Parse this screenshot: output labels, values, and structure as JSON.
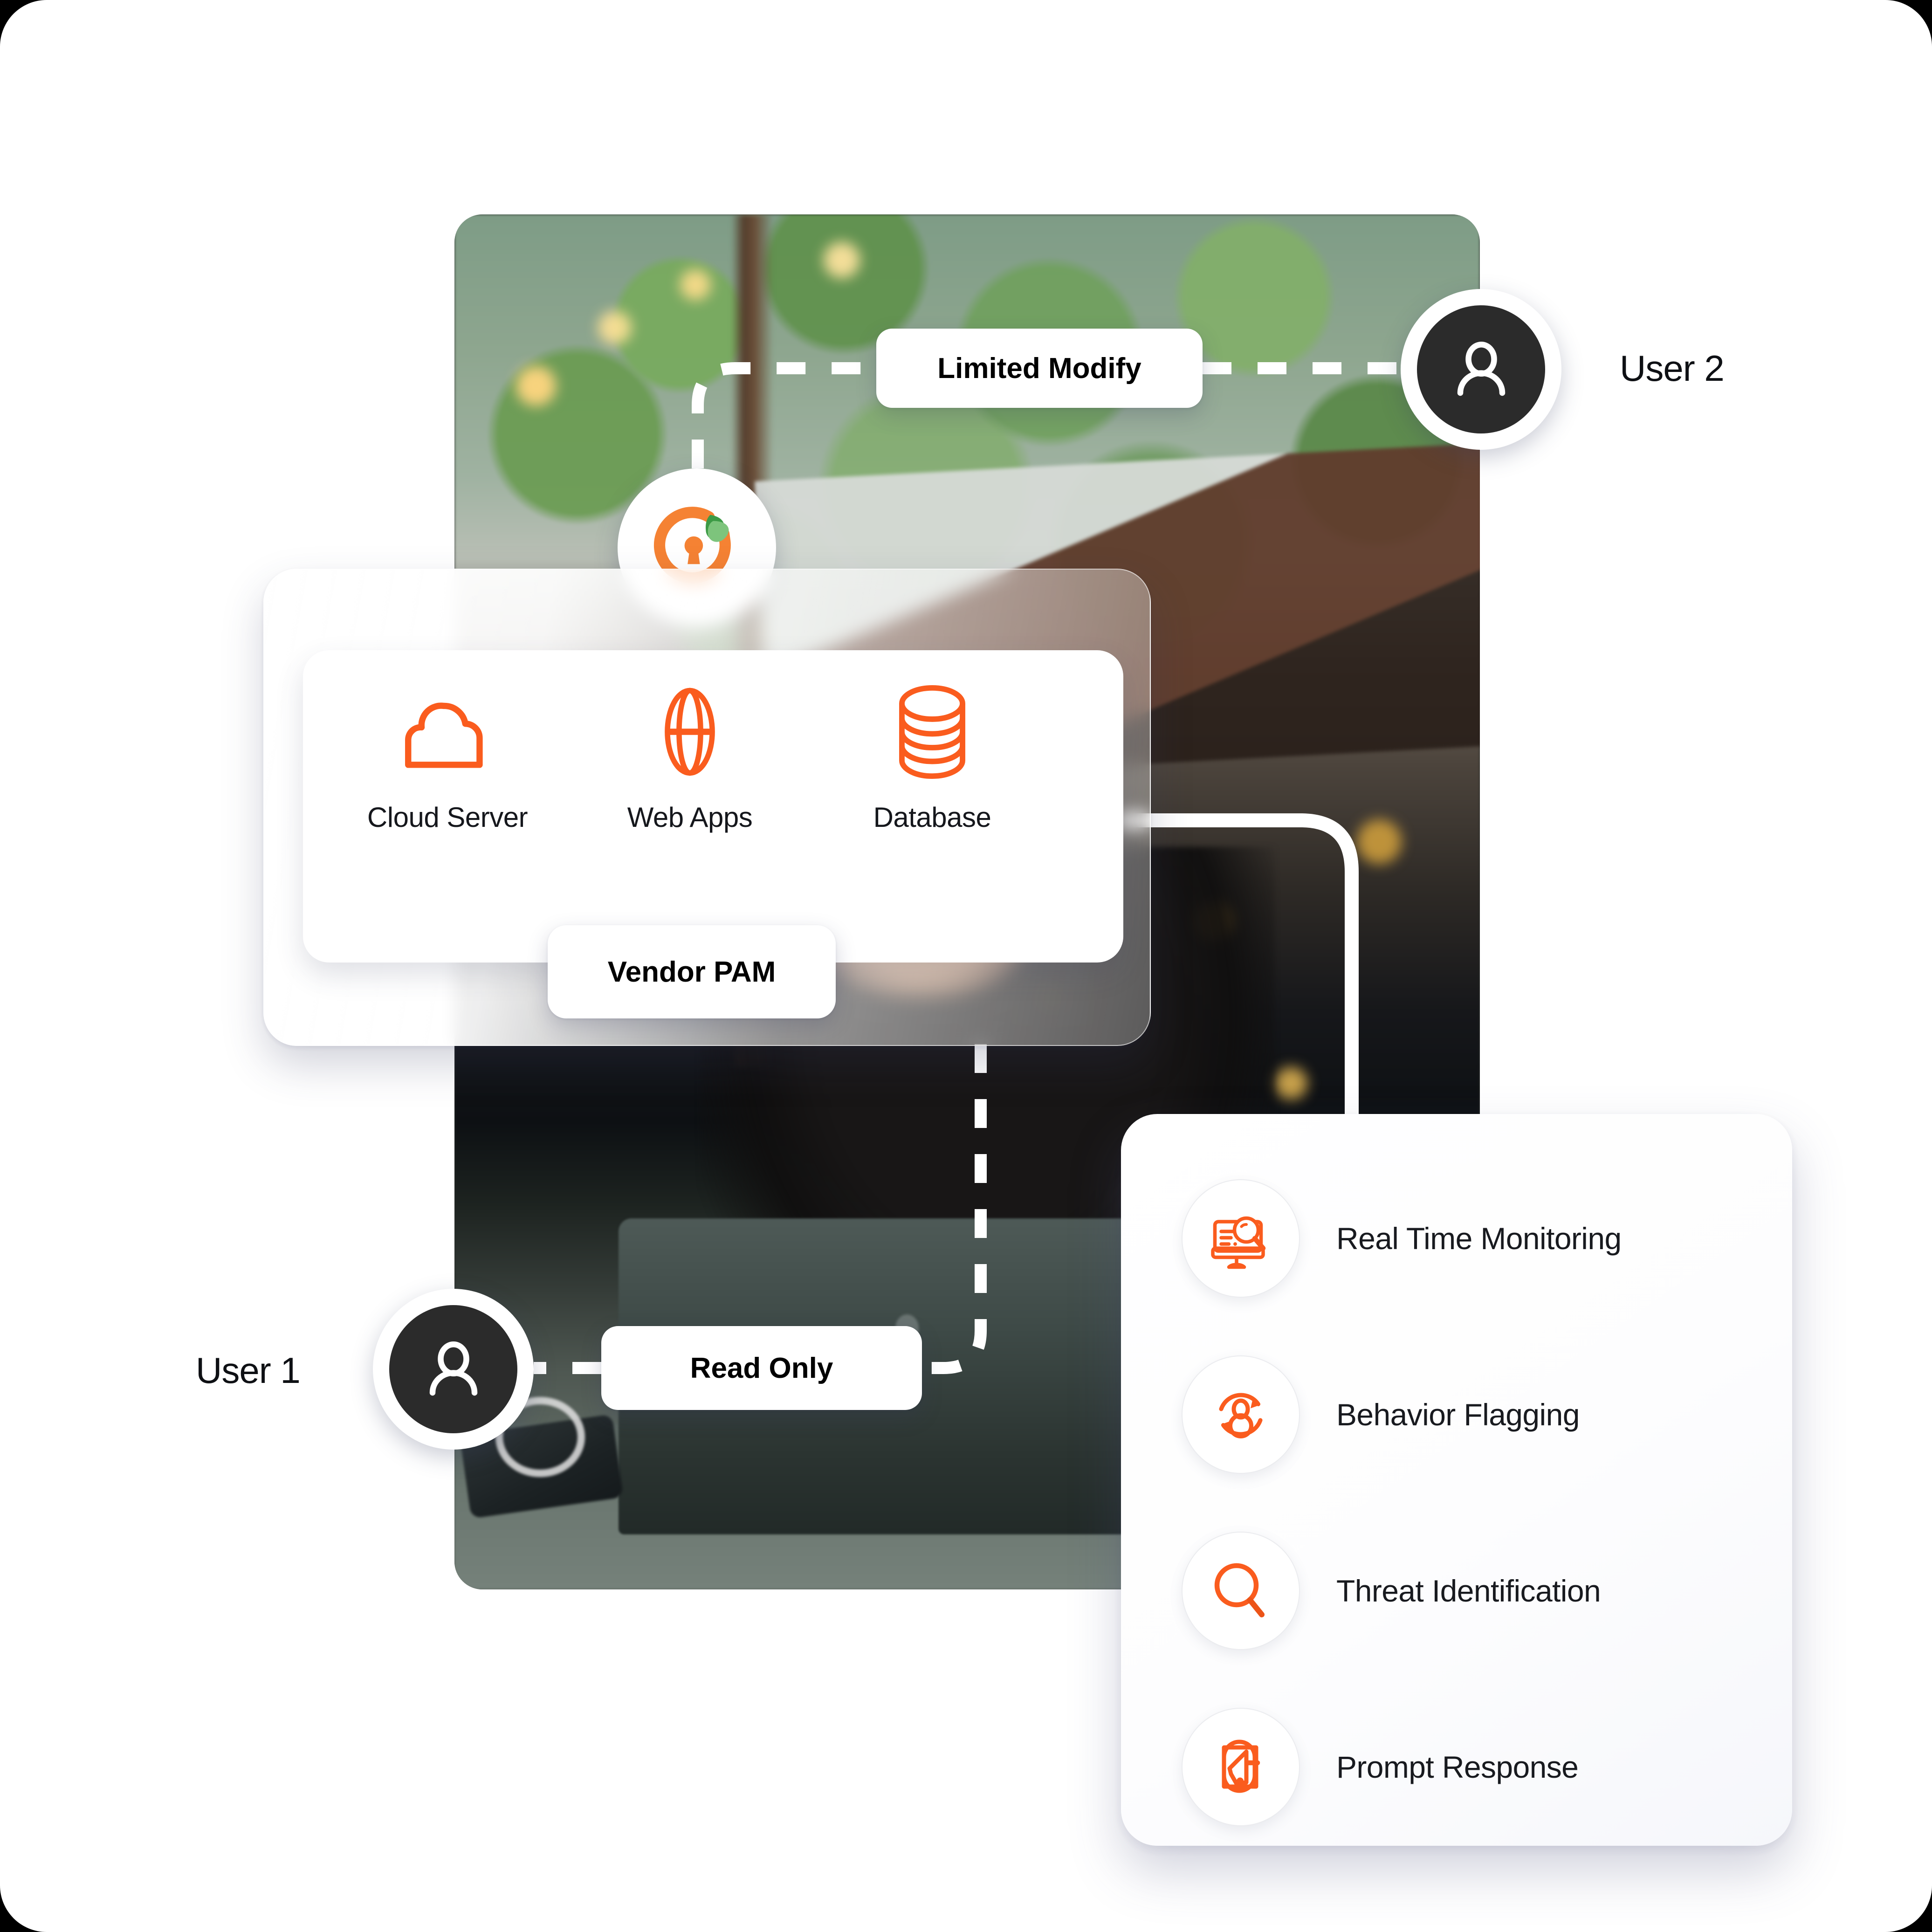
{
  "brand": {
    "logo_icon": "lock-leaf-logo-icon",
    "accent_color": "#F58233",
    "leaf_color": "#4CA64C",
    "service_icon_color": "#FA5C1E"
  },
  "users": [
    {
      "id": "user1",
      "label": "User 1",
      "avatar_icon": "user-avatar-icon",
      "permission": "Read Only"
    },
    {
      "id": "user2",
      "label": "User 2",
      "avatar_icon": "user-avatar-icon",
      "permission": "Limited Modify"
    }
  ],
  "permissions": {
    "limited_modify": "Limited Modify",
    "read_only": "Read Only"
  },
  "pam_card": {
    "title": "Vendor PAM",
    "services": [
      {
        "label": "Cloud Server",
        "icon": "cloud-icon"
      },
      {
        "label": "Web Apps",
        "icon": "globe-icon"
      },
      {
        "label": "Database",
        "icon": "database-icon"
      }
    ]
  },
  "features_panel": {
    "items": [
      {
        "label": "Real Time Monitoring",
        "icon": "monitor-search-icon"
      },
      {
        "label": "Behavior Flagging",
        "icon": "user-refresh-icon"
      },
      {
        "label": "Threat Identification",
        "icon": "magnifier-icon"
      },
      {
        "label": "Prompt Response",
        "icon": "megaphone-icon"
      }
    ]
  }
}
